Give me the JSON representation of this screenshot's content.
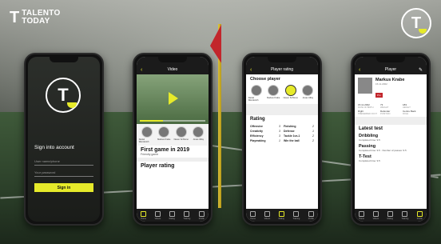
{
  "brand": {
    "name_line1": "TALENTO",
    "name_line2": "TODAY",
    "logo_letter": "T"
  },
  "phones": {
    "login": {
      "title": "Sign into account",
      "username_placeholder": "User name/phone",
      "password_placeholder": "Your password",
      "signin_button": "Sign in"
    },
    "video": {
      "topbar_title": "Video",
      "players": [
        {
          "name": "Daniel Wenderoth"
        },
        {
          "name": "Markus Krabe"
        },
        {
          "name": "Neven Schlomo"
        },
        {
          "name": "Jonas Ulfay"
        }
      ],
      "heading": "First game in 2019",
      "subtext": "Friendly game",
      "section": "Player rating",
      "progress": 0.35
    },
    "rating": {
      "topbar_title": "Player rating",
      "choose_label": "Choose player",
      "players": [
        {
          "name": "Daniel Wenderoth"
        },
        {
          "name": "Markus Krabe"
        },
        {
          "name": "Neven Schlomo"
        },
        {
          "name": "Jonas Ulfay"
        }
      ],
      "rating_heading": "Rating",
      "rows": [
        {
          "a": "Offensive",
          "av": "3",
          "b": "Finishing",
          "bv": "2"
        },
        {
          "a": "Creativity",
          "av": "3",
          "b": "Defense",
          "bv": "1"
        },
        {
          "a": "Efficiency",
          "av": "3",
          "b": "Tackle 1vs.1",
          "bv": "2"
        },
        {
          "a": "Playmaking",
          "av": "1",
          "b": "Win the ball",
          "bv": "2"
        }
      ]
    },
    "player": {
      "topbar_title": "Player",
      "name": "Markus Krabe",
      "dob": "15.11.2002",
      "status_tag": "Pro",
      "info": [
        {
          "label": "DATE OF BIRTH",
          "value": "15.11.2002"
        },
        {
          "label": "WEIGHT",
          "value": "73"
        },
        {
          "label": "HEIGHT",
          "value": "183"
        },
        {
          "label": "PREFERRED FOOT",
          "value": "Right"
        },
        {
          "label": "POSITION",
          "value": "Defender"
        },
        {
          "label": "ROLE",
          "value": "Centre Back"
        }
      ],
      "latest_test": "Latest test",
      "tests": [
        {
          "name": "Dribbling",
          "line": "Completed time: 9.5"
        },
        {
          "name": "Passing",
          "line": "Completed time: 9.5 · Number of passes: 9.5"
        },
        {
          "name": "T-Test",
          "line": "Completed time: 9.5"
        }
      ]
    }
  },
  "tabbar": [
    "Home",
    "Videos",
    "Rating",
    "Training",
    "Profile"
  ],
  "colors": {
    "accent": "#e6ea2a",
    "dark": "#1b1b1b",
    "flag": "#c2262c"
  }
}
